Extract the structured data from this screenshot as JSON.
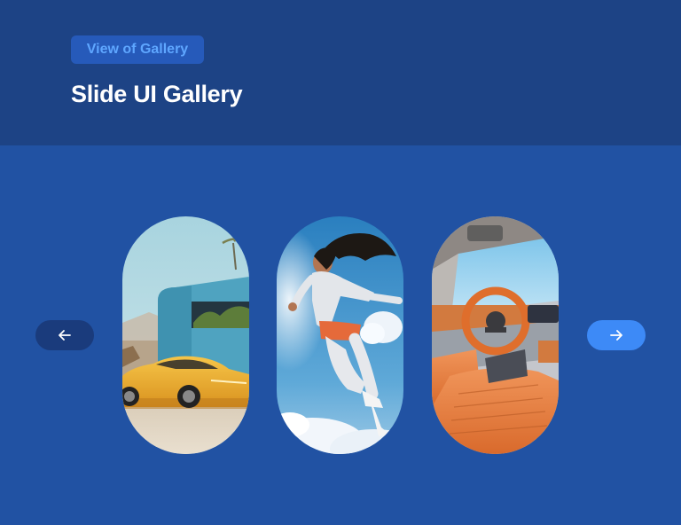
{
  "header": {
    "badge_label": "View of Gallery",
    "title": "Slide UI Gallery"
  },
  "navigation": {
    "prev_icon": "arrow-left-icon",
    "next_icon": "arrow-right-icon"
  },
  "slides": [
    {
      "subject": "yellow-sports-car-in-front-of-modern-building",
      "icon": "image"
    },
    {
      "subject": "woman-jumping-in-sky-with-clouds",
      "icon": "image"
    },
    {
      "subject": "orange-leather-car-interior",
      "icon": "image"
    }
  ],
  "colors": {
    "header_bg": "#1d4385",
    "body_bg": "#2152a3",
    "badge_bg": "#265aba",
    "badge_text": "#5ea6ff",
    "prev_button": "#1a3b7c",
    "next_button": "#3d8af7"
  }
}
